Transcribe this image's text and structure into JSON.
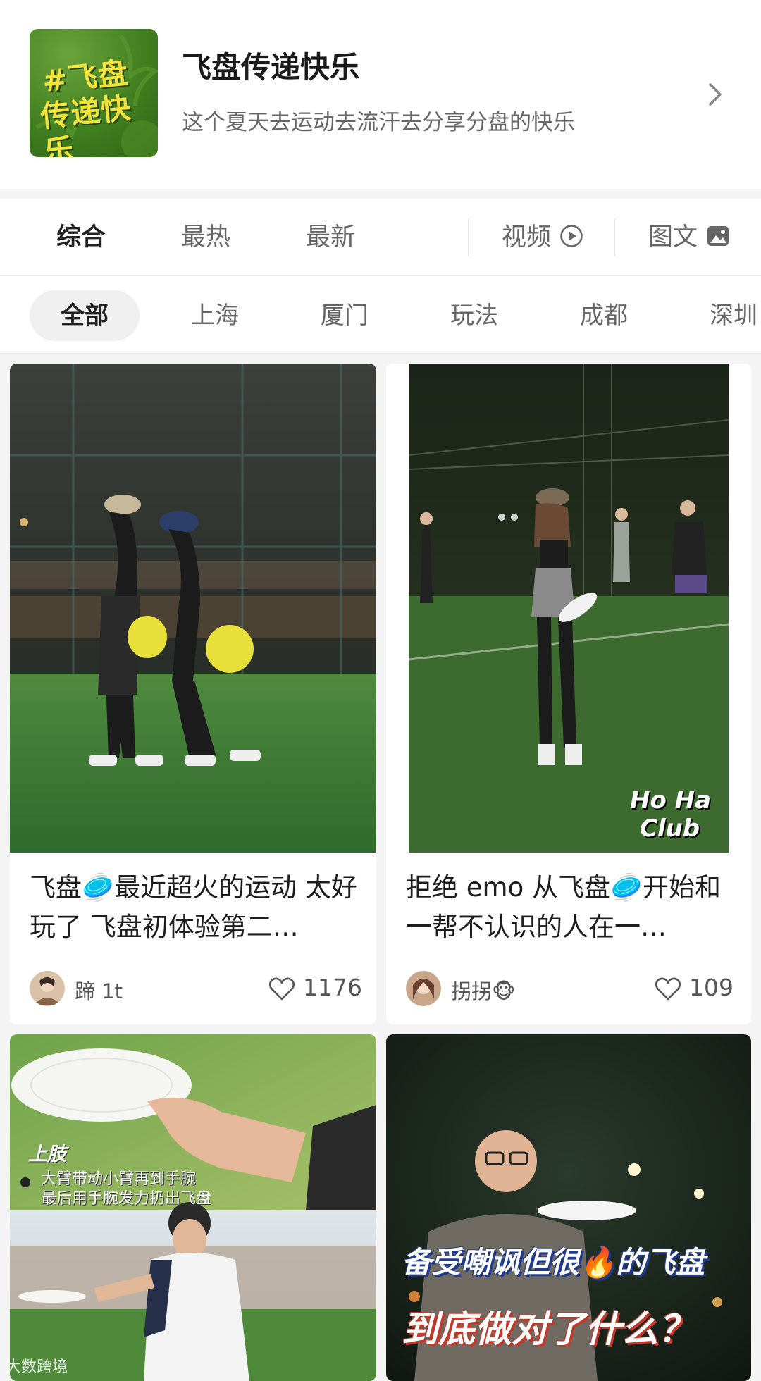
{
  "topic": {
    "cover_line1": "#飞盘",
    "cover_line2": "传递快乐",
    "title": "飞盘传递快乐",
    "description": "这个夏天去运动去流汗去分享分盘的快乐"
  },
  "sort_tabs": [
    {
      "label": "综合",
      "active": true
    },
    {
      "label": "最热",
      "active": false
    },
    {
      "label": "最新",
      "active": false
    }
  ],
  "media_tabs": [
    {
      "label": "视频",
      "icon": "play-circle-icon"
    },
    {
      "label": "图文",
      "icon": "image-icon"
    }
  ],
  "filters": [
    {
      "label": "全部",
      "active": true
    },
    {
      "label": "上海",
      "active": false
    },
    {
      "label": "厦门",
      "active": false
    },
    {
      "label": "玩法",
      "active": false
    },
    {
      "label": "成都",
      "active": false
    },
    {
      "label": "深圳",
      "active": false
    }
  ],
  "posts": [
    {
      "title": "飞盘🥏最近超火的运动 太好玩了 飞盘初体验第二…",
      "author": "蹄 1t",
      "likes": "1176"
    },
    {
      "title": "拒绝 emo 从飞盘🥏开始和一帮不认识的人在一…",
      "author": "拐拐🐵",
      "likes": "109",
      "image_overlay_line1": "Ho Ha",
      "image_overlay_line2": "Club"
    },
    {
      "image_label": "上肢",
      "image_caption_line1": "大臂带动小臂再到手腕",
      "image_caption_line2": "最后用手腕发力扔出飞盘"
    },
    {
      "image_headline1": "备受嘲讽但很🔥的飞盘",
      "image_headline2": "到底做对了什么？"
    }
  ],
  "watermark": "大数跨境",
  "colors": {
    "cover_green": "#3f7d1f",
    "cover_text_yellow": "#f3e23a",
    "frisbee_yellow": "#e8e03a"
  }
}
